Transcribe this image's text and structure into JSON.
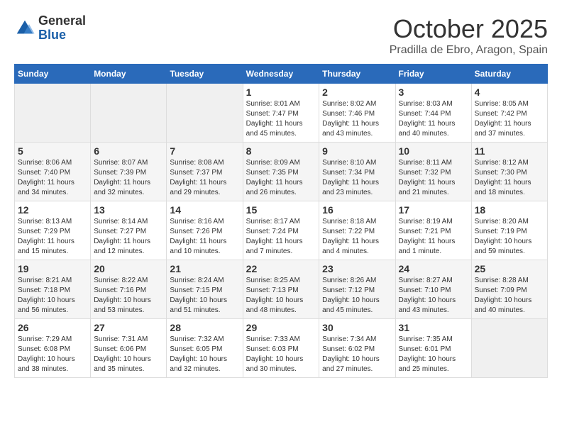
{
  "logo": {
    "general": "General",
    "blue": "Blue"
  },
  "header": {
    "month": "October 2025",
    "location": "Pradilla de Ebro, Aragon, Spain"
  },
  "weekdays": [
    "Sunday",
    "Monday",
    "Tuesday",
    "Wednesday",
    "Thursday",
    "Friday",
    "Saturday"
  ],
  "weeks": [
    [
      {
        "day": "",
        "info": ""
      },
      {
        "day": "",
        "info": ""
      },
      {
        "day": "",
        "info": ""
      },
      {
        "day": "1",
        "info": "Sunrise: 8:01 AM\nSunset: 7:47 PM\nDaylight: 11 hours and 45 minutes."
      },
      {
        "day": "2",
        "info": "Sunrise: 8:02 AM\nSunset: 7:46 PM\nDaylight: 11 hours and 43 minutes."
      },
      {
        "day": "3",
        "info": "Sunrise: 8:03 AM\nSunset: 7:44 PM\nDaylight: 11 hours and 40 minutes."
      },
      {
        "day": "4",
        "info": "Sunrise: 8:05 AM\nSunset: 7:42 PM\nDaylight: 11 hours and 37 minutes."
      }
    ],
    [
      {
        "day": "5",
        "info": "Sunrise: 8:06 AM\nSunset: 7:40 PM\nDaylight: 11 hours and 34 minutes."
      },
      {
        "day": "6",
        "info": "Sunrise: 8:07 AM\nSunset: 7:39 PM\nDaylight: 11 hours and 32 minutes."
      },
      {
        "day": "7",
        "info": "Sunrise: 8:08 AM\nSunset: 7:37 PM\nDaylight: 11 hours and 29 minutes."
      },
      {
        "day": "8",
        "info": "Sunrise: 8:09 AM\nSunset: 7:35 PM\nDaylight: 11 hours and 26 minutes."
      },
      {
        "day": "9",
        "info": "Sunrise: 8:10 AM\nSunset: 7:34 PM\nDaylight: 11 hours and 23 minutes."
      },
      {
        "day": "10",
        "info": "Sunrise: 8:11 AM\nSunset: 7:32 PM\nDaylight: 11 hours and 21 minutes."
      },
      {
        "day": "11",
        "info": "Sunrise: 8:12 AM\nSunset: 7:30 PM\nDaylight: 11 hours and 18 minutes."
      }
    ],
    [
      {
        "day": "12",
        "info": "Sunrise: 8:13 AM\nSunset: 7:29 PM\nDaylight: 11 hours and 15 minutes."
      },
      {
        "day": "13",
        "info": "Sunrise: 8:14 AM\nSunset: 7:27 PM\nDaylight: 11 hours and 12 minutes."
      },
      {
        "day": "14",
        "info": "Sunrise: 8:16 AM\nSunset: 7:26 PM\nDaylight: 11 hours and 10 minutes."
      },
      {
        "day": "15",
        "info": "Sunrise: 8:17 AM\nSunset: 7:24 PM\nDaylight: 11 hours and 7 minutes."
      },
      {
        "day": "16",
        "info": "Sunrise: 8:18 AM\nSunset: 7:22 PM\nDaylight: 11 hours and 4 minutes."
      },
      {
        "day": "17",
        "info": "Sunrise: 8:19 AM\nSunset: 7:21 PM\nDaylight: 11 hours and 1 minute."
      },
      {
        "day": "18",
        "info": "Sunrise: 8:20 AM\nSunset: 7:19 PM\nDaylight: 10 hours and 59 minutes."
      }
    ],
    [
      {
        "day": "19",
        "info": "Sunrise: 8:21 AM\nSunset: 7:18 PM\nDaylight: 10 hours and 56 minutes."
      },
      {
        "day": "20",
        "info": "Sunrise: 8:22 AM\nSunset: 7:16 PM\nDaylight: 10 hours and 53 minutes."
      },
      {
        "day": "21",
        "info": "Sunrise: 8:24 AM\nSunset: 7:15 PM\nDaylight: 10 hours and 51 minutes."
      },
      {
        "day": "22",
        "info": "Sunrise: 8:25 AM\nSunset: 7:13 PM\nDaylight: 10 hours and 48 minutes."
      },
      {
        "day": "23",
        "info": "Sunrise: 8:26 AM\nSunset: 7:12 PM\nDaylight: 10 hours and 45 minutes."
      },
      {
        "day": "24",
        "info": "Sunrise: 8:27 AM\nSunset: 7:10 PM\nDaylight: 10 hours and 43 minutes."
      },
      {
        "day": "25",
        "info": "Sunrise: 8:28 AM\nSunset: 7:09 PM\nDaylight: 10 hours and 40 minutes."
      }
    ],
    [
      {
        "day": "26",
        "info": "Sunrise: 7:29 AM\nSunset: 6:08 PM\nDaylight: 10 hours and 38 minutes."
      },
      {
        "day": "27",
        "info": "Sunrise: 7:31 AM\nSunset: 6:06 PM\nDaylight: 10 hours and 35 minutes."
      },
      {
        "day": "28",
        "info": "Sunrise: 7:32 AM\nSunset: 6:05 PM\nDaylight: 10 hours and 32 minutes."
      },
      {
        "day": "29",
        "info": "Sunrise: 7:33 AM\nSunset: 6:03 PM\nDaylight: 10 hours and 30 minutes."
      },
      {
        "day": "30",
        "info": "Sunrise: 7:34 AM\nSunset: 6:02 PM\nDaylight: 10 hours and 27 minutes."
      },
      {
        "day": "31",
        "info": "Sunrise: 7:35 AM\nSunset: 6:01 PM\nDaylight: 10 hours and 25 minutes."
      },
      {
        "day": "",
        "info": ""
      }
    ]
  ]
}
